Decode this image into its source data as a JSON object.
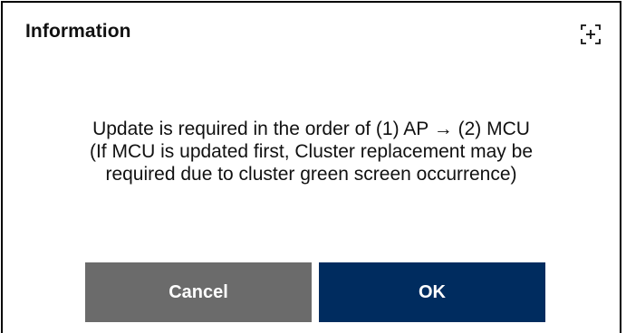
{
  "dialog": {
    "title": "Information",
    "expand_icon": "expand-corners-plus-icon",
    "message_lines": [
      "Update is required in the order of (1) AP → (2) MCU",
      "(If MCU is updated first, Cluster replacement may be",
      "required due to cluster green screen occurrence)"
    ],
    "cancel_label": "Cancel",
    "ok_label": "OK"
  },
  "colors": {
    "cancel_button": "#6b6b6b",
    "ok_button": "#002c5f",
    "text": "#111111",
    "border": "#000000"
  }
}
